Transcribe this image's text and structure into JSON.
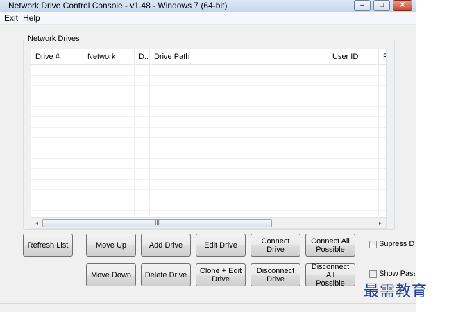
{
  "window": {
    "title": "Network Drive Control Console - v1.48 - Windows 7  (64-bit)",
    "caption_buttons": {
      "minimize": "–",
      "maximize": "□",
      "close": "✕"
    }
  },
  "menu": {
    "items": [
      "Exit",
      "Help"
    ]
  },
  "group": {
    "label": "Network Drives"
  },
  "list": {
    "columns": [
      "Drive #",
      "Network",
      "D..",
      "Drive Path",
      "User ID",
      "P"
    ],
    "rows": [],
    "scroll_grip": "III",
    "scroll_left": "◂",
    "scroll_right": "▸"
  },
  "buttons": {
    "refresh_list": "Refresh List",
    "move_up": "Move Up",
    "add_drive": "Add Drive",
    "edit_drive": "Edit Drive",
    "connect_drive": "Connect Drive",
    "connect_all_possible_l1": "Connect All",
    "connect_all_possible_l2": "Possible",
    "move_down": "Move Down",
    "delete_drive": "Delete Drive",
    "clone_edit_l1": "Clone + Edit",
    "clone_edit_l2": "Drive",
    "disconnect_drive_l1": "Disconnect",
    "disconnect_drive_l2": "Drive",
    "disconnect_all_l1": "Disconnect All",
    "disconnect_all_l2": "Possible"
  },
  "checkboxes": {
    "suppress": {
      "label": "Supress Dri",
      "checked": false
    },
    "show_pass": {
      "label": "Show Passw",
      "checked": false
    }
  },
  "watermark": {
    "text": "最需教育"
  }
}
